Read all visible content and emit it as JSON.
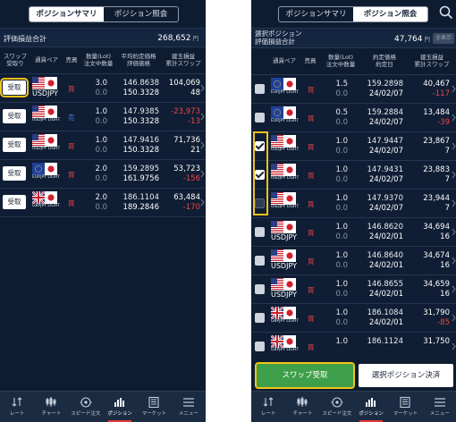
{
  "left": {
    "tabs": [
      "ポジションサマリ",
      "ポジション照会"
    ],
    "active_tab": 0,
    "summary": {
      "label": "評価損益合計",
      "value": "268,652",
      "unit": "円"
    },
    "headers": {
      "swap": [
        "スワップ",
        "受取り"
      ],
      "pair": "通貨ペア",
      "side": "売買",
      "qty": [
        "数量(Lot)",
        "注文中数量"
      ],
      "price": [
        "平均約定価格",
        "評価価格"
      ],
      "pl": [
        "建玉損益",
        "累計スワップ"
      ]
    },
    "recv_label": "受取",
    "rows": [
      {
        "pair_text": "USDJPY",
        "pair_small": "",
        "flag": "us-jp",
        "side": "買",
        "side_type": "buy-red",
        "qty": "3.0",
        "qty_pending": "0.0",
        "avg_price": "146.8638",
        "eval_price": "150.3328",
        "pl": "104,069",
        "swap": "48",
        "swap_neg": false,
        "highlight": true
      },
      {
        "pair_text": "",
        "pair_small": "USDJPY LIGHT",
        "flag": "us-jp",
        "side": "売",
        "side_type": "sell-blue",
        "qty": "1.0",
        "qty_pending": "0.0",
        "avg_price": "147.9385",
        "eval_price": "150.3328",
        "pl": "-23,973",
        "swap": "-13",
        "swap_neg": true,
        "pl_neg": true,
        "highlight": false
      },
      {
        "pair_text": "",
        "pair_small": "USDJPY LIGHT",
        "flag": "us-jp",
        "side": "買",
        "side_type": "buy-red",
        "qty": "1.0",
        "qty_pending": "0.0",
        "avg_price": "147.9416",
        "eval_price": "150.3328",
        "pl": "71,736",
        "swap": "21",
        "swap_neg": false,
        "highlight": false
      },
      {
        "pair_text": "",
        "pair_small": "EURJPY LIGHT",
        "flag": "eu-jp",
        "side": "買",
        "side_type": "buy-red",
        "qty": "2.0",
        "qty_pending": "0.0",
        "avg_price": "159.2895",
        "eval_price": "161.9756",
        "pl": "53,723",
        "swap": "-156",
        "swap_neg": true,
        "highlight": false
      },
      {
        "pair_text": "",
        "pair_small": "GBPJPY LIGHT",
        "flag": "gb-jp",
        "side": "買",
        "side_type": "buy-red",
        "qty": "2.0",
        "qty_pending": "0.0",
        "avg_price": "186.1104",
        "eval_price": "189.2846",
        "pl": "63,484",
        "swap": "-170",
        "swap_neg": true,
        "highlight": false
      }
    ]
  },
  "right": {
    "tabs": [
      "ポジションサマリ",
      "ポジション照会"
    ],
    "active_tab": 1,
    "summary": {
      "label_lines": [
        "選択ポジション",
        "評価損益合計"
      ],
      "value": "47,764",
      "unit": "円",
      "all_label": "全表示"
    },
    "headers": {
      "pair": "通貨ペア",
      "side": "売買",
      "qty": [
        "数量(Lot)",
        "注文中数量"
      ],
      "price": [
        "約定価格",
        "約定日"
      ],
      "pl": [
        "建玉損益",
        "累計スワップ"
      ]
    },
    "rows": [
      {
        "pair_text": "",
        "pair_small": "EURJPY LIGHT",
        "flag": "eu-jp",
        "side": "買",
        "qty": "1.5",
        "qty_pending": "0.0",
        "price": "159.2898",
        "date": "24/02/07",
        "pl": "40,467",
        "swap": "-117",
        "swap_neg": true,
        "check": "off"
      },
      {
        "pair_text": "",
        "pair_small": "EURJPY LIGHT",
        "flag": "eu-jp",
        "side": "買",
        "qty": "0.5",
        "qty_pending": "0.0",
        "price": "159.2884",
        "date": "24/02/07",
        "pl": "13,484",
        "swap": "-39",
        "swap_neg": true,
        "check": "off"
      },
      {
        "pair_text": "",
        "pair_small": "USDJPY LIGHT",
        "flag": "us-jp",
        "side": "買",
        "qty": "1.0",
        "qty_pending": "0.0",
        "price": "147.9447",
        "date": "24/02/07",
        "pl": "23,867",
        "swap": "7",
        "swap_neg": false,
        "check": "on"
      },
      {
        "pair_text": "",
        "pair_small": "USDJPY LIGHT",
        "flag": "us-jp",
        "side": "買",
        "qty": "1.0",
        "qty_pending": "0.0",
        "price": "147.9431",
        "date": "24/02/07",
        "pl": "23,883",
        "swap": "7",
        "swap_neg": false,
        "check": "on"
      },
      {
        "pair_text": "",
        "pair_small": "USDJPY LIGHT",
        "flag": "us-jp",
        "side": "買",
        "qty": "1.0",
        "qty_pending": "0.0",
        "price": "147.9370",
        "date": "24/02/07",
        "pl": "23,944",
        "swap": "7",
        "swap_neg": false,
        "check": "dim"
      },
      {
        "pair_text": "USDJPY",
        "pair_small": "",
        "flag": "us-jp",
        "side": "買",
        "qty": "1.0",
        "qty_pending": "0.0",
        "price": "146.8620",
        "date": "24/02/01",
        "pl": "34,694",
        "swap": "16",
        "swap_neg": false,
        "check": "off"
      },
      {
        "pair_text": "USDJPY",
        "pair_small": "",
        "flag": "us-jp",
        "side": "買",
        "qty": "1.0",
        "qty_pending": "0.0",
        "price": "146.8640",
        "date": "24/02/01",
        "pl": "34,674",
        "swap": "16",
        "swap_neg": false,
        "check": "off"
      },
      {
        "pair_text": "USDJPY",
        "pair_small": "",
        "flag": "us-jp",
        "side": "買",
        "qty": "1.0",
        "qty_pending": "0.0",
        "price": "146.8655",
        "date": "24/02/01",
        "pl": "34,659",
        "swap": "16",
        "swap_neg": false,
        "check": "off"
      },
      {
        "pair_text": "",
        "pair_small": "GBPJPY LIGHT",
        "flag": "gb-jp",
        "side": "買",
        "qty": "1.0",
        "qty_pending": "0.0",
        "price": "186.1084",
        "date": "24/02/01",
        "pl": "31,790",
        "swap": "-85",
        "swap_neg": true,
        "check": "off"
      },
      {
        "pair_text": "",
        "pair_small": "GBPJPY LIGHT",
        "flag": "gb-jp",
        "side": "買",
        "qty": "1.0",
        "qty_pending": "",
        "price": "186.1124",
        "date": "",
        "pl": "31,750",
        "swap": "",
        "swap_neg": true,
        "check": "off"
      }
    ],
    "swap_button": "スワップ受取",
    "settle_button": "選択ポジション決済"
  },
  "tabbar": [
    {
      "label": "レート",
      "icon": "rate-icon"
    },
    {
      "label": "チャート",
      "icon": "chart-icon"
    },
    {
      "label": "スピード注文",
      "icon": "speed-order-icon"
    },
    {
      "label": "ポジション",
      "icon": "position-icon",
      "active": true
    },
    {
      "label": "マーケット",
      "icon": "market-icon"
    },
    {
      "label": "メニュー",
      "icon": "menu-icon"
    }
  ],
  "colors": {
    "background": "#0e1c31",
    "negative": "#ef4444",
    "buy_side": "#ef4040",
    "sell_side": "#3d7fe0",
    "highlight": "#f3c318",
    "swap_button": "#3ea04a",
    "active_tab_indicator": "#e23a3a"
  }
}
